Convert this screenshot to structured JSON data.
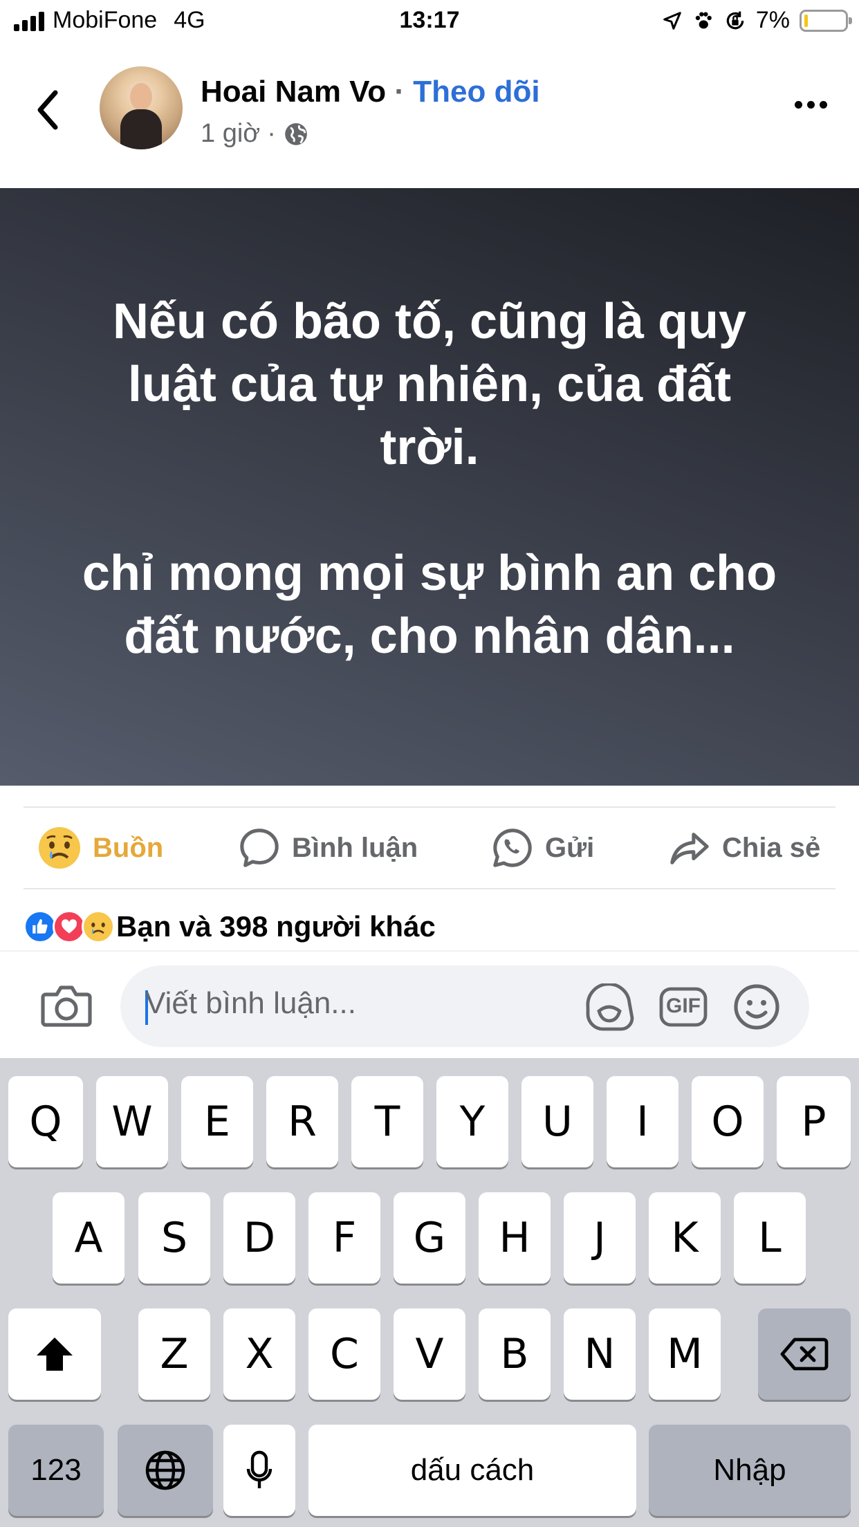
{
  "status_bar": {
    "carrier": "MobiFone",
    "network": "4G",
    "time": "13:17",
    "battery": "7%",
    "battery_color": "#f5c518"
  },
  "post": {
    "author": "Hoai Nam Vo",
    "separator": "·",
    "follow_label": "Theo dõi",
    "time_ago": "1 giờ",
    "meta_separator": "·",
    "audience_icon": "globe-icon",
    "text_lines_1": [
      "Nếu có bão tố, cũng là quy",
      "luật của tự nhiên, của đất",
      "trời."
    ],
    "text_lines_2": [
      "chỉ mong mọi sự bình an cho",
      "đất nước, cho nhân dân..."
    ]
  },
  "actions": {
    "reaction": "Buồn",
    "comment": "Bình luận",
    "send": "Gửi",
    "share": "Chia sẻ"
  },
  "reactions_summary": "Bạn và 398 người khác",
  "comment_input": {
    "placeholder": "Viết bình luận...",
    "gif_label": "GIF"
  },
  "keyboard": {
    "row1": [
      "Q",
      "W",
      "E",
      "R",
      "T",
      "Y",
      "U",
      "I",
      "O",
      "P"
    ],
    "row2": [
      "A",
      "S",
      "D",
      "F",
      "G",
      "H",
      "J",
      "K",
      "L"
    ],
    "row3": [
      "Z",
      "X",
      "C",
      "V",
      "B",
      "N",
      "M"
    ],
    "numbers_label": "123",
    "space_label": "dấu cách",
    "return_label": "Nhập"
  },
  "colors": {
    "accent": "#2d6fd6",
    "reaction_sad": "#e5a83a",
    "secondary_text": "#65676b"
  }
}
